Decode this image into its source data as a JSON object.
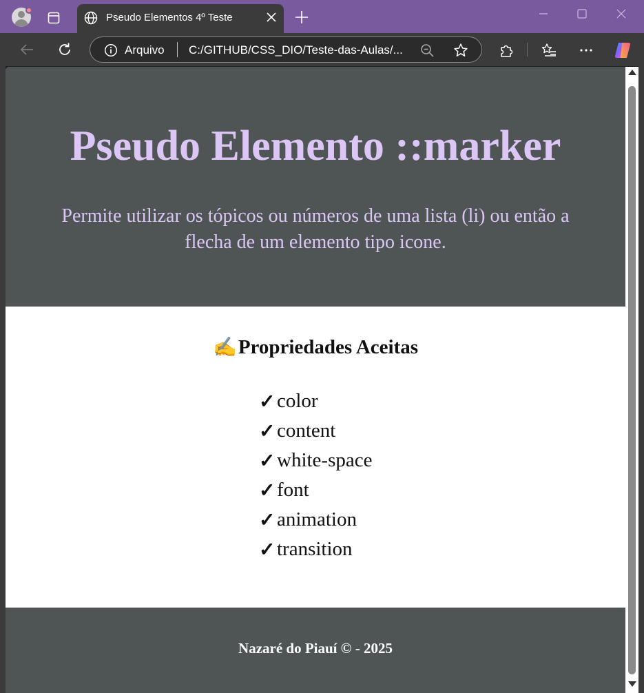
{
  "browser": {
    "tab_title": "Pseudo Elementos 4º Teste",
    "address_scheme": "Arquivo",
    "address_url": "C:/GITHUB/CSS_DIO/Teste-das-Aulas/..."
  },
  "page": {
    "title": "Pseudo Elemento ::marker",
    "description": "Permite utilizar os tópicos ou números de uma lista (li) ou então a flecha de um elemento tipo icone.",
    "section": {
      "emoji": "✍️",
      "heading": "Propriedades Aceitas",
      "check_glyph": "✓",
      "items": [
        "color",
        "content",
        "white-space",
        "font",
        "animation",
        "transition"
      ]
    },
    "footer": "Nazaré do Piauí © - 2025"
  },
  "colors": {
    "titlebar": "#7a5a9e",
    "toolbar": "#3b3b3b",
    "header_bg": "#4f5555",
    "title_text": "#dcc6f6",
    "footer_text": "#ffffff"
  }
}
